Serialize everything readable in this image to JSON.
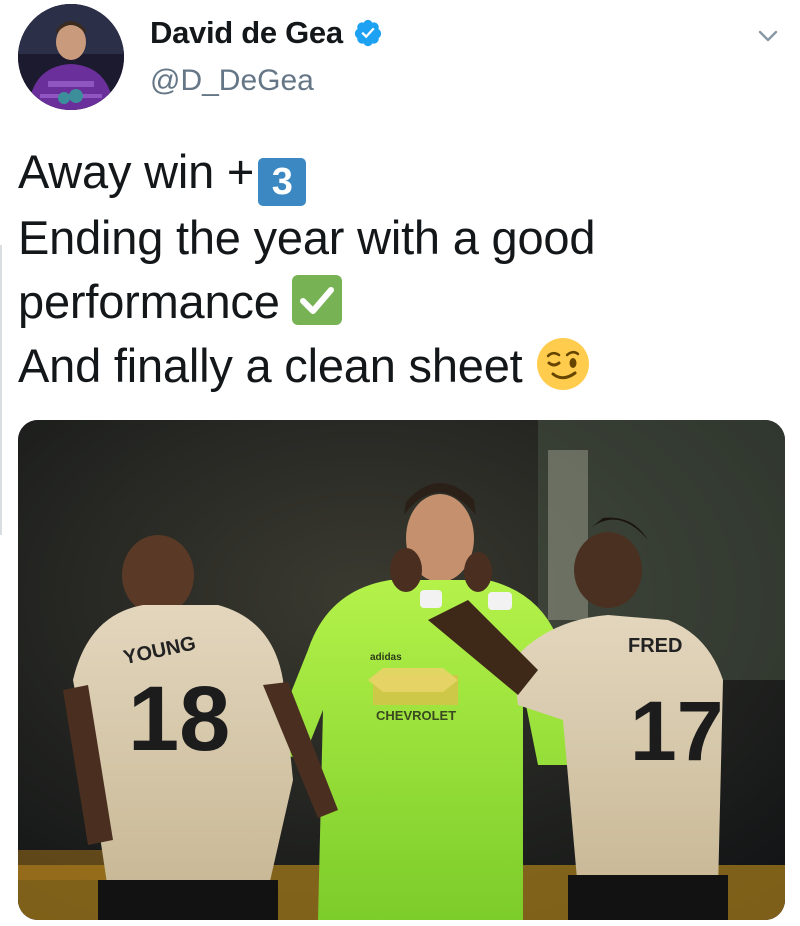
{
  "author": {
    "display_name": "David de Gea",
    "handle": "@D_DeGea",
    "verified": true,
    "avatar_icon": "profile-photo"
  },
  "tweet": {
    "line1": "Away win +",
    "line1_emoji": "3",
    "line2": "Ending the year with a good",
    "line3": "performance",
    "line4": "And finally a clean sheet",
    "emojis": [
      "keycap-3",
      "check-mark-button",
      "winking-face"
    ]
  },
  "media": {
    "description_icon": "football-photo",
    "jerseys": {
      "left_name": "YOUNG",
      "left_number": "18",
      "right_name": "FRED",
      "right_number": "17",
      "sponsor": "CHEVROLET",
      "brand": "adidas"
    }
  },
  "colors": {
    "verified_blue": "#1da1f2",
    "handle_gray": "#657786",
    "keycap_blue": "#3b88c3",
    "check_green": "#77b255",
    "keeper_kit": "#9be33a",
    "away_kit": "#d8c9ae"
  }
}
